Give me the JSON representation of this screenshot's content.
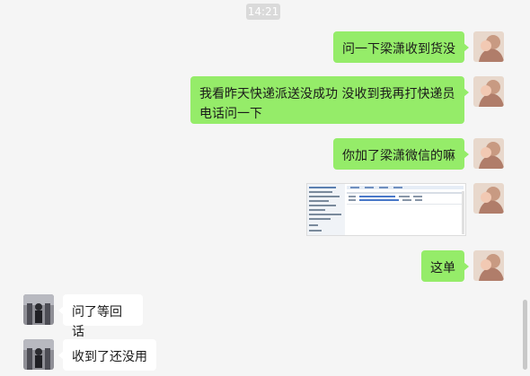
{
  "chat": {
    "time": "14:21",
    "messages": [
      {
        "side": "right",
        "text": "问一下梁潇收到货没"
      },
      {
        "side": "right",
        "text": "我看昨天快递派送没成功 没收到我再打快递员电话问一下"
      },
      {
        "side": "right",
        "text": "你加了梁潇微信的嘛"
      },
      {
        "side": "right",
        "type": "image",
        "label": "screenshot-thumbnail"
      },
      {
        "side": "right",
        "text": "这单"
      },
      {
        "side": "left",
        "text": "问了等回话"
      },
      {
        "side": "left",
        "text": "收到了还没用"
      }
    ]
  },
  "colors": {
    "background": "#f5f5f5",
    "outgoing_bubble": "#95ec69",
    "incoming_bubble": "#ffffff",
    "time_badge": "#dadada"
  },
  "icons": [
    "avatar-self",
    "avatar-contact"
  ]
}
